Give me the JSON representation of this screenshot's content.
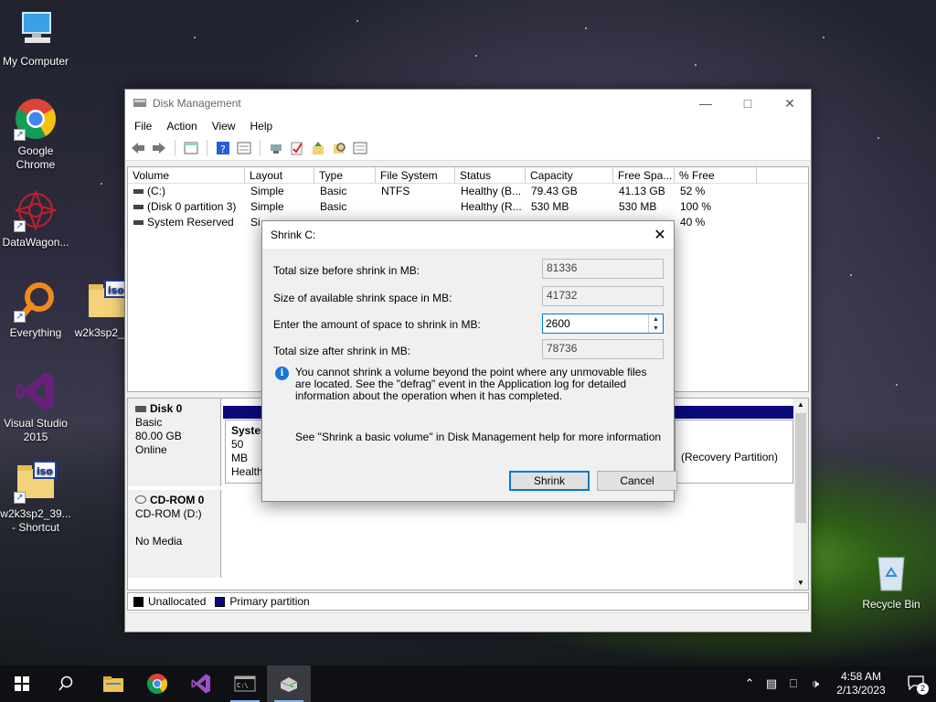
{
  "desktop": {
    "icons": [
      {
        "label": "My Computer"
      },
      {
        "label": "Google Chrome"
      },
      {
        "label": "DataWagon..."
      },
      {
        "label": "Everything"
      },
      {
        "label": "w2k3sp2_3..."
      },
      {
        "label": "Visual Studio 2015"
      },
      {
        "label": "w2k3sp2_39... - Shortcut"
      },
      {
        "label": "Recycle Bin"
      }
    ]
  },
  "window": {
    "title": "Disk Management",
    "menu": [
      "File",
      "Action",
      "View",
      "Help"
    ],
    "columns": [
      "Volume",
      "Layout",
      "Type",
      "File System",
      "Status",
      "Capacity",
      "Free Spa...",
      "% Free"
    ],
    "volumes": [
      {
        "volume": "(C:)",
        "layout": "Simple",
        "type": "Basic",
        "fs": "NTFS",
        "status": "Healthy (B...",
        "capacity": "79.43 GB",
        "free": "41.13 GB",
        "pct": "52 %"
      },
      {
        "volume": "(Disk 0 partition 3)",
        "layout": "Simple",
        "type": "Basic",
        "fs": "",
        "status": "Healthy (R...",
        "capacity": "530 MB",
        "free": "530 MB",
        "pct": "100 %"
      },
      {
        "volume": "System Reserved",
        "layout": "Si",
        "type": "",
        "fs": "",
        "status": "",
        "capacity": "",
        "free": "",
        "pct": "40 %"
      }
    ],
    "disks": {
      "disk0": {
        "name": "Disk 0",
        "type": "Basic",
        "size": "80.00 GB",
        "state": "Online",
        "partition_left": {
          "title": "System",
          "line1": "50 MB",
          "line2": "Healthy"
        },
        "partition_right": {
          "label": "(Recovery Partition)"
        }
      },
      "cdrom0": {
        "name": "CD-ROM 0",
        "type": "CD-ROM (D:)",
        "state": "No Media"
      }
    },
    "legend": {
      "unallocated": "Unallocated",
      "primary": "Primary partition"
    }
  },
  "dialog": {
    "title": "Shrink C:",
    "total_before_label": "Total size before shrink in MB:",
    "total_before_value": "81336",
    "available_label": "Size of available shrink space in MB:",
    "available_value": "41732",
    "amount_label": "Enter the amount of space to shrink in MB:",
    "amount_value": "2600",
    "total_after_label": "Total size after shrink in MB:",
    "total_after_value": "78736",
    "info_text": "You cannot shrink a volume beyond the point where any unmovable files are located. See the \"defrag\" event in the Application log for detailed information about the operation when it has completed.",
    "help_text": "See \"Shrink a basic volume\" in Disk Management help for more information",
    "shrink_button": "Shrink",
    "cancel_button": "Cancel"
  },
  "taskbar": {
    "time": "4:58 AM",
    "date": "2/13/2023",
    "notification_count": "2"
  }
}
